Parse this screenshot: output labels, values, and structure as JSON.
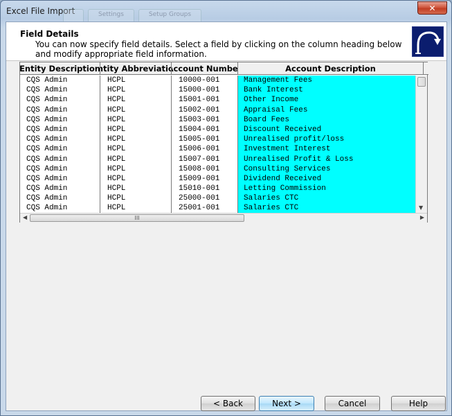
{
  "window": {
    "title": "Excel File Import",
    "close_label": "✕"
  },
  "ghost_tabs": [
    "",
    "Settings",
    "Setup Groups"
  ],
  "header": {
    "title": "Field Details",
    "description": "You can now specify field details. Select a field by clicking on the column heading below and modify appropriate field information."
  },
  "grid": {
    "columns": [
      "Entity Description",
      "Entity Abbreviation",
      "Account Number",
      "Account Description"
    ],
    "rows": [
      [
        "CQS Admin",
        "HCPL",
        "10000-001",
        "Management Fees"
      ],
      [
        "CQS Admin",
        "HCPL",
        "15000-001",
        "Bank Interest"
      ],
      [
        "CQS Admin",
        "HCPL",
        "15001-001",
        "Other Income"
      ],
      [
        "CQS Admin",
        "HCPL",
        "15002-001",
        "Appraisal Fees"
      ],
      [
        "CQS Admin",
        "HCPL",
        "15003-001",
        "Board Fees"
      ],
      [
        "CQS Admin",
        "HCPL",
        "15004-001",
        "Discount Received"
      ],
      [
        "CQS Admin",
        "HCPL",
        "15005-001",
        "Unrealised profit/loss"
      ],
      [
        "CQS Admin",
        "HCPL",
        "15006-001",
        "Investment Interest"
      ],
      [
        "CQS Admin",
        "HCPL",
        "15007-001",
        "Unrealised Profit & Loss"
      ],
      [
        "CQS Admin",
        "HCPL",
        "15008-001",
        "Consulting Services"
      ],
      [
        "CQS Admin",
        "HCPL",
        "15009-001",
        "Dividend Received"
      ],
      [
        "CQS Admin",
        "HCPL",
        "15010-001",
        "Letting Commission"
      ],
      [
        "CQS Admin",
        "HCPL",
        "25000-001",
        "Salaries CTC"
      ],
      [
        "CQS Admin",
        "HCPL",
        "25001-001",
        "Salaries CTC"
      ]
    ],
    "selected_column_color": "#00ffff",
    "hscroll_grip": "III"
  },
  "buttons": {
    "back": "< Back",
    "next": "Next >",
    "cancel": "Cancel",
    "help": "Help"
  },
  "colors": {
    "logo_bg": "#0b1d6e",
    "close_bg": "#c13d24"
  }
}
